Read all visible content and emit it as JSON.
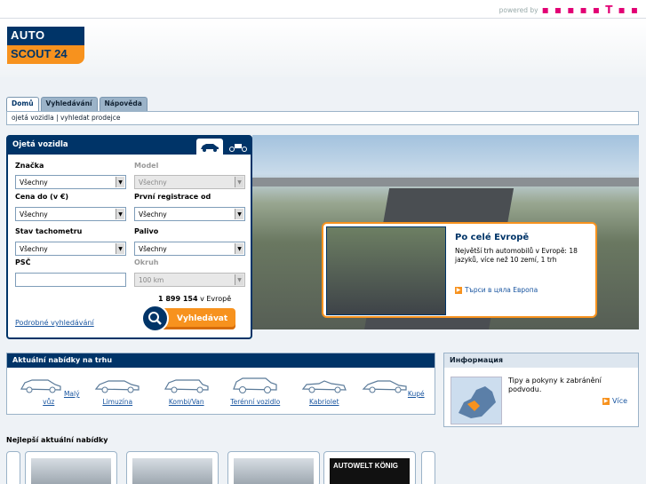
{
  "topbar": {
    "powered_by": "powered by",
    "brand_logo": "T"
  },
  "logo": {
    "line1": "AUTO",
    "line2": "SCOUT 24"
  },
  "tabs": [
    {
      "label": "Domů",
      "active": true
    },
    {
      "label": "Vyhledávání"
    },
    {
      "label": "Nápověda"
    }
  ],
  "subnav": "ojetá vozidla | vyhledat prodejce",
  "search": {
    "title": "Ojetá vozidla",
    "fields": {
      "make_label": "Značka",
      "make_value": "Všechny",
      "model_label": "Model",
      "model_value": "Všechny",
      "price_label": "Cena do (v €)",
      "price_value": "Všechny",
      "reg_label": "První registrace od",
      "reg_value": "Všechny",
      "km_label": "Stav tachometru",
      "km_value": "Všechny",
      "fuel_label": "Palivo",
      "fuel_value": "Všechny",
      "zip_label": "PSČ",
      "zip_value": "",
      "radius_label": "Okruh",
      "radius_value": "100 km"
    },
    "count": "1 899 154",
    "count_suffix": " v Evropě",
    "detail_link": "Podrobné vyhledávání",
    "button": "Vyhledávat"
  },
  "promo": {
    "title": "Po celé Evropě",
    "text": "Největší trh automobilů v Evropě: 18 jazyků, více než 10 zemí, 1 trh",
    "link": "Търси в цяла Европа"
  },
  "categories": {
    "title": "Aktuální nabídky na trhu",
    "items": [
      "Malý vůz",
      "Limuzína",
      "Kombi/Van",
      "Terénní vozidlo",
      "Kabriolet",
      "Kupé"
    ]
  },
  "info": {
    "title": "Информация",
    "text": "Tipy a pokyny k zabránění podvodu.",
    "more": "Více"
  },
  "best": {
    "title": "Nejlepší aktuální nabídky",
    "dealer": "AUTOWELT KÖNIG"
  }
}
